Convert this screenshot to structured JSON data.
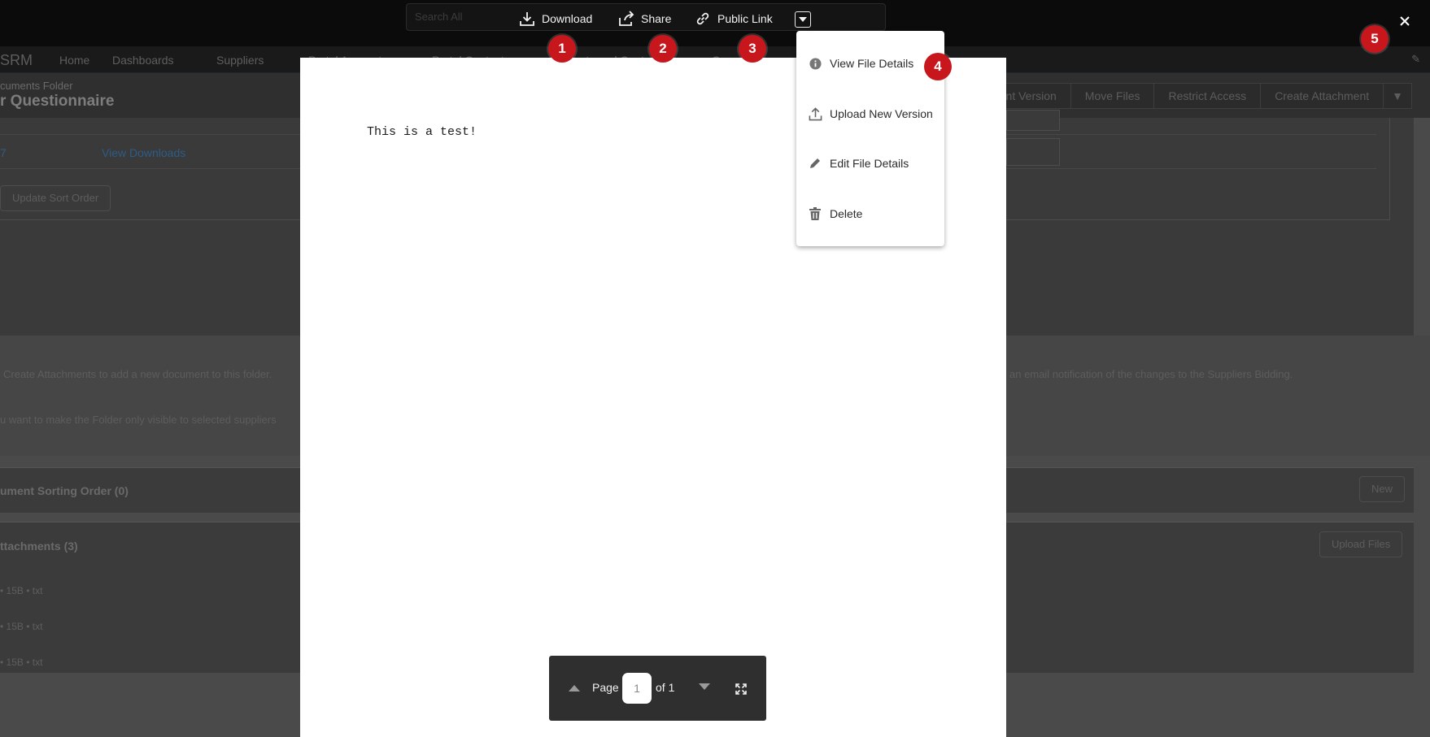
{
  "background": {
    "app_name": "SRM",
    "nav_items": [
      "Home",
      "Dashboards",
      "Suppliers",
      "Portal Accounts",
      "Portal Contacts",
      "Products and Contr",
      "Case",
      "and"
    ],
    "search_scope": "Search All",
    "breadcrumb": "cuments Folder",
    "title": "r Questionnaire",
    "actions": [
      "nt Version",
      "Move Files",
      "Restrict Access",
      "Create Attachment"
    ],
    "partial_row_number": "7",
    "view_downloads": "View Downloads",
    "update_sort_button": "Update Sort Order",
    "help_lines": [
      "Create Attachments to add a new document to this folder.",
      "an email notification of the changes to the Suppliers Bidding.",
      "u want to make the Folder only visible to selected suppliers"
    ],
    "sorting_section": "ument Sorting Order (0)",
    "new_button": "New",
    "attachments_section": "ttachments (3)",
    "upload_files_button": "Upload Files",
    "file_rows": [
      "• 15B • txt",
      "• 15B • txt",
      "• 15B • txt"
    ]
  },
  "viewer": {
    "toolbar": {
      "download": "Download",
      "share": "Share",
      "public_link": "Public Link"
    },
    "document_text": "This is a test!",
    "menu": {
      "items": [
        "View File Details",
        "Upload New Version",
        "Edit File Details",
        "Delete"
      ]
    },
    "pager": {
      "page_label": "Page",
      "current_page": "1",
      "of_label": "of 1"
    }
  },
  "annotations": [
    "1",
    "2",
    "3",
    "4",
    "5"
  ],
  "colors": {
    "badge": "#c8161d",
    "overlay_bar": "#0b0b0b",
    "link": "#2d5c86"
  }
}
